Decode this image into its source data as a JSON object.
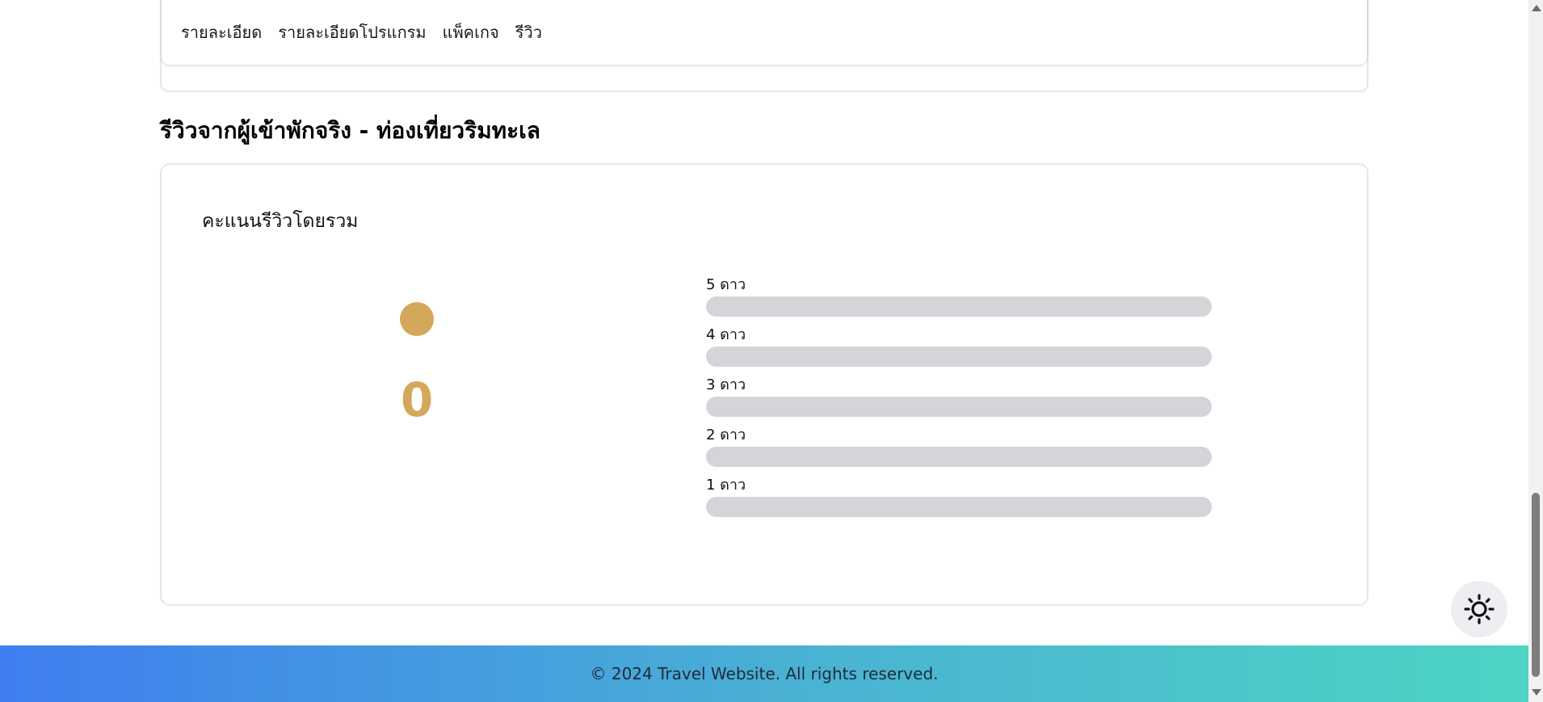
{
  "tabs": [
    {
      "label": "รายละเอียด"
    },
    {
      "label": "รายละเอียดโปรแกรม"
    },
    {
      "label": "แพ็คเกจ"
    },
    {
      "label": "รีวิว"
    }
  ],
  "reviews": {
    "section_title": "รีวิวจากผู้เข้าพักจริง - ท่องเที่ยวริมทะเล",
    "overall_title": "คะแนนรีวิวโดยรวม",
    "score": "0",
    "accent_color": "#d4a85b",
    "rating_bars": [
      {
        "label": "5 ดาว",
        "fraction": 0
      },
      {
        "label": "4 ดาว",
        "fraction": 0
      },
      {
        "label": "3 ดาว",
        "fraction": 0
      },
      {
        "label": "2 ดาว",
        "fraction": 0
      },
      {
        "label": "1 ดาว",
        "fraction": 0
      }
    ]
  },
  "footer": {
    "copyright": "© 2024 Travel Website. All rights reserved."
  },
  "theme_toggle": {
    "icon": "sun-icon"
  }
}
